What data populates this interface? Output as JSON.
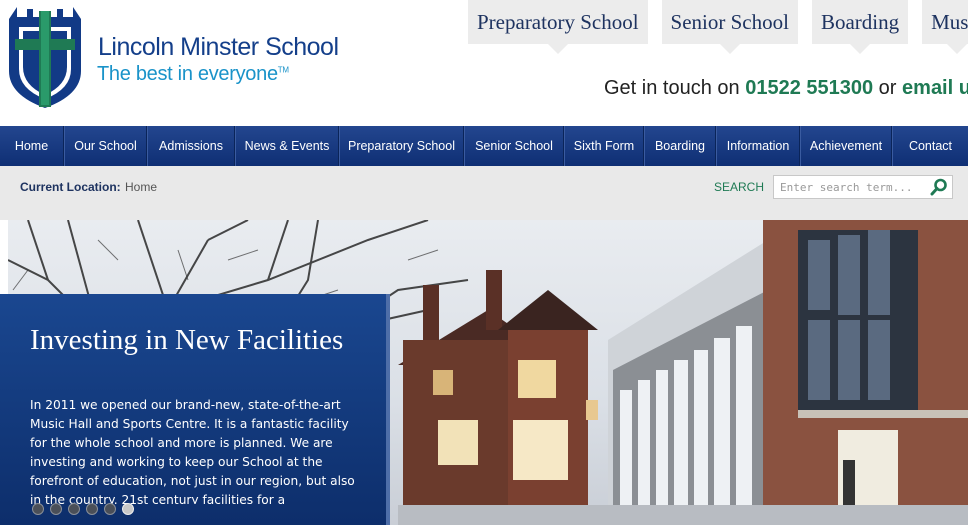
{
  "header": {
    "school_name": "Lincoln Minster School",
    "tagline": "The best in everyone",
    "tagline_mark": "TM",
    "top_tabs": [
      "Preparatory School",
      "Senior School",
      "Boarding",
      "Music"
    ],
    "contact_prefix": "Get in touch on ",
    "phone": "01522 551300",
    "contact_or": " or ",
    "email_link": "email us"
  },
  "nav": {
    "items": [
      "Home",
      "Our School",
      "Admissions",
      "News & Events",
      "Preparatory School",
      "Senior School",
      "Sixth Form",
      "Boarding",
      "Information",
      "Achievement",
      "Contact"
    ]
  },
  "breadcrumb": {
    "label": "Current Location:",
    "value": "Home"
  },
  "search": {
    "label": "SEARCH",
    "placeholder": "Enter search term..."
  },
  "hero": {
    "title": "Investing in New Facilities",
    "body": "In 2011 we opened our brand-new, state-of-the-art Music Hall and Sports Centre. It is a fantastic facility for the whole school and more is planned. We are investing and working to keep our School at the forefront of education, not just in our region, but also in the country. 21st century facilities for a",
    "slide_count": 6,
    "active_slide": 6
  },
  "colors": {
    "brand_blue": "#143f8a",
    "tagline_blue": "#1a93c9",
    "accent_green": "#1f7a54",
    "nav_blue": "#1a3c82"
  }
}
